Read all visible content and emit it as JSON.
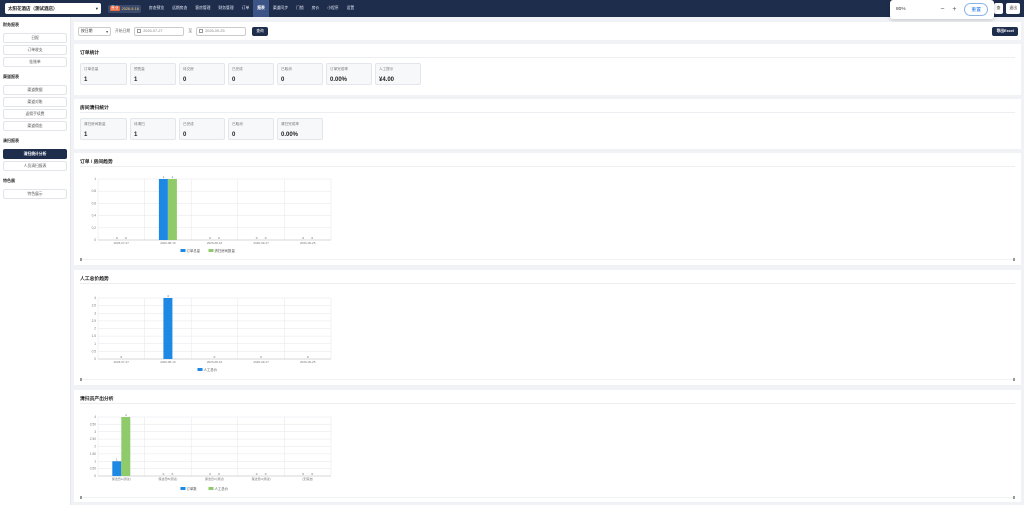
{
  "topnav": {
    "hotel_name": "太阳花酒店（测试酒店）",
    "date_tag": "营业",
    "date_value": "2026-9-16",
    "items": [
      "房态预览",
      "远期房态",
      "客房管理",
      "财务管理",
      "订单",
      "报表",
      "渠道同步",
      "门锁",
      "房价",
      "小程序",
      "设置"
    ],
    "active_index": 5,
    "right_buttons": [
      "查",
      "退出"
    ]
  },
  "zoom": {
    "value": "80%",
    "minus": "−",
    "plus": "+",
    "reset_label": "重置"
  },
  "sidebar": {
    "groups": [
      {
        "title": "财务报表",
        "items": [
          "日报",
          "订单收支",
          "挂账单"
        ]
      },
      {
        "title": "渠道报表",
        "items": [
          "渠道数据",
          "渠道对账",
          "返佣手续费",
          "渠道佣金"
        ]
      },
      {
        "title": "清扫报表",
        "items": [
          "清扫统计分析",
          "人员清扫报表"
        ]
      },
      {
        "title": "特色展",
        "items": [
          "特色展示"
        ]
      }
    ],
    "active_label": "清扫统计分析"
  },
  "filter": {
    "select_value": "按日期",
    "label_start": "开始日期",
    "start_date": "2026-07-27",
    "tilde": "至",
    "end_date": "2026-09-25",
    "query_label": "查询",
    "export_label": "导出Excel"
  },
  "order_stats": {
    "title": "订单统计",
    "items": [
      {
        "k": "订单总量",
        "v": "1"
      },
      {
        "k": "预售量",
        "v": "1"
      },
      {
        "k": "待交房",
        "v": "0"
      },
      {
        "k": "已完成",
        "v": "0"
      },
      {
        "k": "已取消",
        "v": "0"
      },
      {
        "k": "订单完成率",
        "v": "0.00%"
      },
      {
        "k": "人工提示",
        "v": "¥4.00"
      }
    ]
  },
  "room_stats": {
    "title": "房间清扫统计",
    "items": [
      {
        "k": "清扫房间数量",
        "v": "1"
      },
      {
        "k": "待清扫",
        "v": "1"
      },
      {
        "k": "已完成",
        "v": "0"
      },
      {
        "k": "已取消",
        "v": "0"
      },
      {
        "k": "清扫完成率",
        "v": "0.00%"
      }
    ]
  },
  "charts": {
    "chart1_title": "订单 / 房间趋势",
    "chart2_title": "人工总价趋势",
    "chart3_title": "清扫员产出分析"
  },
  "chart_data": [
    {
      "type": "bar",
      "categories": [
        "2026-07-27",
        "2026-08-13",
        "2026-08-16",
        "2026-09-17",
        "2026-09-25"
      ],
      "series": [
        {
          "name": "订单总量",
          "values": [
            0,
            1,
            0,
            0,
            0
          ],
          "color": "#1e88e5"
        },
        {
          "name": "清扫房间数量",
          "values": [
            0,
            1,
            0,
            0,
            0
          ],
          "color": "#8fcb6b"
        }
      ],
      "ylim": [
        0,
        1
      ],
      "yticks": [
        0,
        0.2,
        0.4,
        0.6,
        0.8,
        1
      ],
      "ytick_labels": [
        "0",
        "0.2",
        "0.4",
        "0.6",
        "0.8",
        "1"
      ],
      "grid": true,
      "legend": "bottom"
    },
    {
      "type": "bar",
      "categories": [
        "2026-07-27",
        "2026-08-13",
        "2026-08-16",
        "2026-09-17",
        "2026-09-25"
      ],
      "series": [
        {
          "name": "人工总价",
          "values": [
            0,
            4,
            0,
            0,
            0
          ],
          "color": "#1e88e5"
        }
      ],
      "ylim": [
        0,
        4
      ],
      "yticks": [
        0,
        0.5,
        1,
        1.5,
        2,
        2.5,
        3,
        3.5,
        4
      ],
      "ytick_labels": [
        "0",
        "0.5",
        "1",
        "1.5",
        "2",
        "2.5",
        "3",
        "3.5",
        "4"
      ],
      "grid": true,
      "legend": "bottom"
    },
    {
      "type": "bar",
      "categories": [
        "保洁员A(测试)",
        "保洁员B(测试)",
        "保洁员C(测试)",
        "保洁员D(测试)",
        "(无保洁)"
      ],
      "series": [
        {
          "name": "订单数",
          "values": [
            1,
            0,
            0,
            0,
            0
          ],
          "color": "#1e88e5"
        },
        {
          "name": "人工总价",
          "values": [
            4,
            0,
            0,
            0,
            0
          ],
          "color": "#8fcb6b"
        }
      ],
      "ylim": [
        0,
        4
      ],
      "yticks": [
        0,
        0.5,
        1,
        1.5,
        2,
        2.5,
        3,
        3.5,
        4
      ],
      "ytick_labels": [
        "0",
        "0.50",
        "1",
        "1.50",
        "2",
        "2.50",
        "3",
        "3.50",
        "4"
      ],
      "grid": true,
      "legend": "bottom"
    }
  ]
}
